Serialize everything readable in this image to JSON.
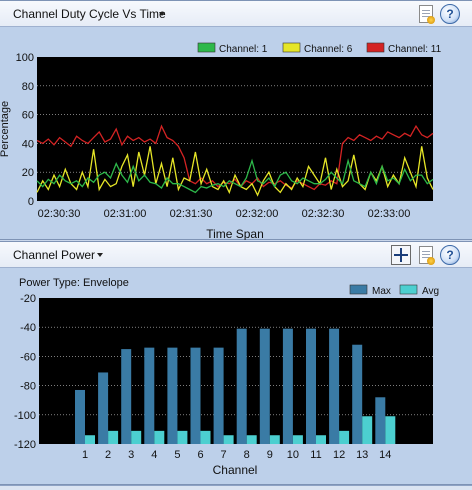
{
  "duty_panel": {
    "title": "Channel Duty Cycle Vs Time"
  },
  "power_panel": {
    "title": "Channel Power",
    "power_type_label": "Power Type: Envelope"
  },
  "colors": {
    "plot_background": "#000000",
    "gridline": "#c8c8c8",
    "channel1": "#2db84a",
    "channel6": "#e6e627",
    "channel11": "#d42323",
    "max_bar": "#3a7ba5",
    "avg_bar": "#4ccfd0"
  },
  "chart_data": [
    {
      "type": "line",
      "xlabel": "Time Span",
      "ylabel": "Percentage",
      "ylim": [
        0,
        100
      ],
      "yticks": [
        0,
        20,
        40,
        60,
        80,
        100
      ],
      "xticks": [
        "02:30:30",
        "02:31:00",
        "02:31:30",
        "02:32:00",
        "02:32:30",
        "02:33:00"
      ],
      "x_start": "02:30:30",
      "x_interval_seconds": 3,
      "legend_position": "top-right",
      "grid": true,
      "series": [
        {
          "name": "Channel: 1",
          "color": "#2db84a",
          "values": [
            14,
            10,
            15,
            12,
            18,
            14,
            12,
            14,
            10,
            16,
            13,
            18,
            20,
            16,
            26,
            18,
            13,
            24,
            14,
            18,
            13,
            12,
            9,
            16,
            12,
            12,
            10,
            8,
            6,
            10,
            9,
            11,
            12,
            10,
            14,
            12,
            10,
            16,
            28,
            14,
            12,
            16,
            10,
            18,
            20,
            14,
            12,
            16,
            14,
            12,
            12,
            15,
            20,
            16,
            12,
            28,
            14,
            12,
            10,
            20,
            12,
            24,
            14,
            16,
            12,
            22,
            14,
            18,
            18,
            12,
            15
          ]
        },
        {
          "name": "Channel: 6",
          "color": "#e6e627",
          "values": [
            6,
            14,
            8,
            18,
            10,
            22,
            12,
            8,
            20,
            10,
            36,
            8,
            15,
            10,
            12,
            24,
            32,
            10,
            34,
            18,
            38,
            12,
            26,
            10,
            30,
            8,
            16,
            14,
            34,
            12,
            22,
            10,
            8,
            14,
            6,
            18,
            10,
            8,
            12,
            4,
            14,
            20,
            10,
            6,
            12,
            8,
            16,
            10,
            24,
            18,
            12,
            30,
            8,
            22,
            10,
            14,
            32,
            12,
            8,
            20,
            14,
            24,
            10,
            18,
            12,
            30,
            20,
            10,
            38,
            16,
            8
          ]
        },
        {
          "name": "Channel: 11",
          "color": "#d42323",
          "values": [
            42,
            40,
            43,
            39,
            44,
            41,
            38,
            45,
            42,
            40,
            44,
            48,
            41,
            43,
            50,
            39,
            45,
            42,
            44,
            41,
            43,
            40,
            52,
            44,
            42,
            38,
            30,
            14,
            12,
            16,
            12,
            14,
            10,
            13,
            12,
            15,
            10,
            14,
            12,
            16,
            10,
            13,
            12,
            14,
            11,
            9,
            14,
            12,
            10,
            8,
            12,
            11,
            14,
            12,
            40,
            44,
            42,
            46,
            44,
            42,
            45,
            43,
            48,
            46,
            44,
            47,
            45,
            52,
            46,
            44,
            47
          ]
        }
      ]
    },
    {
      "type": "bar",
      "xlabel": "Channel",
      "ylabel": "",
      "ylim": [
        -120,
        -20
      ],
      "yticks": [
        -120,
        -100,
        -80,
        -60,
        -40,
        -20
      ],
      "categories": [
        "1",
        "2",
        "3",
        "4",
        "5",
        "6",
        "7",
        "8",
        "9",
        "10",
        "11",
        "12",
        "13",
        "14"
      ],
      "legend_position": "top-right",
      "grid": true,
      "series": [
        {
          "name": "Max",
          "color": "#3a7ba5",
          "values": [
            -83,
            -71,
            -55,
            -54,
            -54,
            -54,
            -54,
            -41,
            -41,
            -41,
            -41,
            -41,
            -52,
            -88
          ]
        },
        {
          "name": "Avg",
          "color": "#4ccfd0",
          "values": [
            -114,
            -111,
            -111,
            -111,
            -111,
            -111,
            -114,
            -114,
            -114,
            -114,
            -114,
            -111,
            -101,
            -101
          ]
        }
      ]
    }
  ]
}
